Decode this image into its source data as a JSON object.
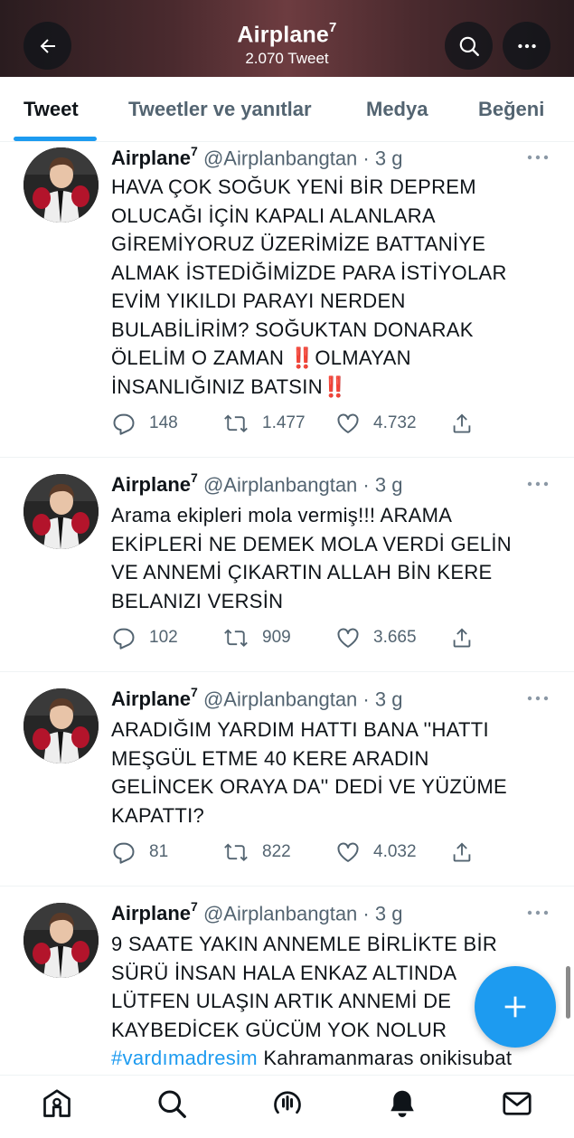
{
  "header": {
    "title": "Airplane",
    "title_sup": "7",
    "subtitle": "2.070 Tweet",
    "back_icon": "arrow-left-icon",
    "search_icon": "search-icon",
    "more_icon": "more-icon"
  },
  "tabs": [
    {
      "label": "Tweet",
      "active": true
    },
    {
      "label": "Tweetler ve yanıtlar",
      "active": false
    },
    {
      "label": "Medya",
      "active": false
    },
    {
      "label": "Beğeni",
      "active": false
    }
  ],
  "tweets": [
    {
      "name": "Airplane",
      "name_sup": "7",
      "handle": "@Airplanbangtan · 3 g",
      "lines": [
        "HAVA ÇOK SOĞUK YENİ BİR DEPREM",
        "OLUCAĞI İÇİN KAPALI ALANLARA",
        "GİREMİYORUZ ÜZERİMİZE BATTANİYE",
        "ALMAK İSTEDİĞİMİZDE PARA İSTİYOLAR",
        "EVİM YIKILDI PARAYI NERDEN",
        "BULABİLİRİM? SOĞUKTAN DONARAK"
      ],
      "line7_a": "ÖLELİM O ZAMAN ",
      "line7_emoji": "‼️",
      "line7_b": "OLMAYAN",
      "line8_a": "İNSANLIĞINIZ BATSIN",
      "line8_emoji": "‼️",
      "replies": "148",
      "retweets": "1.477",
      "likes": "4.732"
    },
    {
      "name": "Airplane",
      "name_sup": "7",
      "handle": "@Airplanbangtan · 3 g",
      "lines": [
        "Arama ekipleri mola vermiş!!! ARAMA",
        "EKİPLERİ NE DEMEK MOLA VERDİ GELİN",
        "VE ANNEMİ ÇIKARTIN ALLAH BİN KERE",
        "BELANIZI VERSİN"
      ],
      "replies": "102",
      "retweets": "909",
      "likes": "3.665"
    },
    {
      "name": "Airplane",
      "name_sup": "7",
      "handle": "@Airplanbangtan · 3 g",
      "lines": [
        "ARADIĞIM YARDIM HATTI BANA ''HATTI",
        "MEŞGÜL ETME 40 KERE ARADIN",
        "GELİNCEK ORAYA DA'' DEDİ VE YÜZÜME",
        "KAPATTI?"
      ],
      "replies": "81",
      "retweets": "822",
      "likes": "4.032"
    },
    {
      "name": "Airplane",
      "name_sup": "7",
      "handle": "@Airplanbangtan · 3 g",
      "lines": [
        "9 SAATE YAKIN ANNEMLE BİRLİKTE BİR",
        "SÜRÜ İNSAN HALA ENKAZ ALTINDA",
        "LÜTFEN ULAŞIN ARTIK ANNEMİ DE",
        "KAYBEDİCEK GÜCÜM YOK NOLUR"
      ],
      "hashtag": "#vardımadresim",
      "tail": " Kahramanmaras onikisubat"
    }
  ],
  "fab": {
    "icon": "plus-icon"
  },
  "bottom_nav": [
    "home-icon",
    "search-icon",
    "spaces-icon",
    "notifications-icon",
    "messages-icon"
  ],
  "colors": {
    "accent": "#1d9bf0",
    "text": "#0f1419",
    "secondary": "#536471",
    "emoji": "#e0245e"
  }
}
